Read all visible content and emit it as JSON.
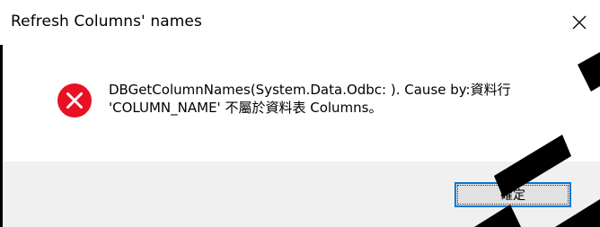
{
  "window": {
    "title": "Refresh Columns' names",
    "close_icon": "close-x"
  },
  "message": {
    "icon": "error-icon",
    "line1": "DBGetColumnNames(System.Data.Odbc: ). Cause by:資料行",
    "line2": "'COLUMN_NAME' 不屬於資料表 Columns。"
  },
  "buttons": {
    "ok_label": "確定"
  },
  "colors": {
    "error_red": "#e81123",
    "focus_blue": "#0078d7",
    "footer_bg": "#f0f0f0"
  }
}
